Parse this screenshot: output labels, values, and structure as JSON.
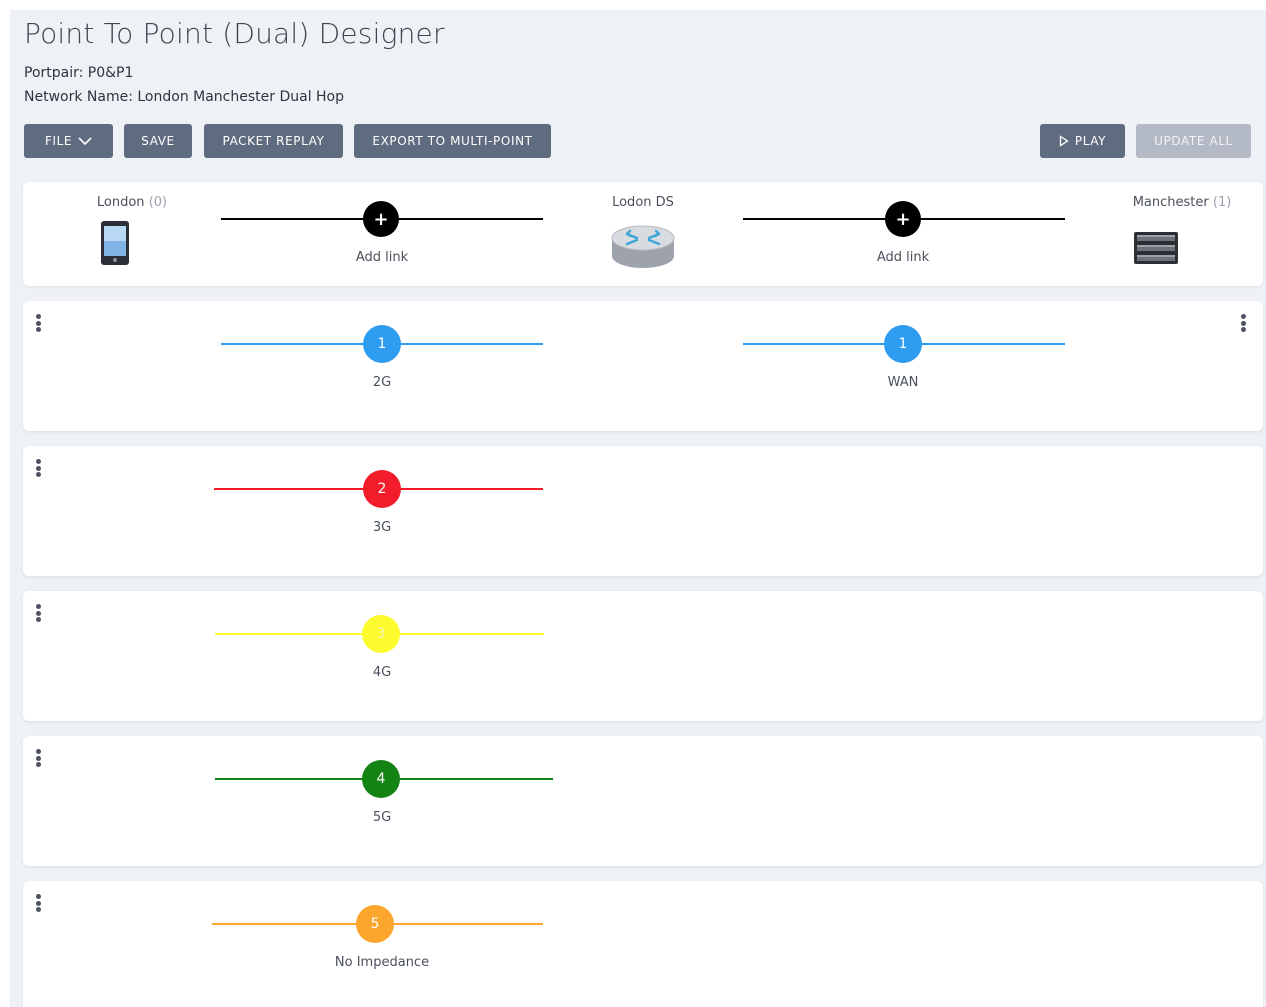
{
  "header": {
    "title": "Point To Point (Dual) Designer",
    "portpair": "Portpair: P0&P1",
    "network_name": "Network Name: London Manchester Dual Hop"
  },
  "toolbar": {
    "file": "FILE",
    "save": "SAVE",
    "packet_replay": "PACKET REPLAY",
    "export": "EXPORT TO MULTI-POINT",
    "play": "PLAY",
    "update_all": "UPDATE ALL"
  },
  "topology": {
    "left": {
      "name": "London",
      "count": "(0)",
      "icon": "mobile-phone-icon"
    },
    "middle": {
      "name": "Lodon DS",
      "icon": "router-icon"
    },
    "right": {
      "name": "Manchester",
      "count": "(1)",
      "icon": "server-icon"
    },
    "add_link_symbol": "+",
    "add_link_label": "Add link"
  },
  "links": [
    {
      "number": "1",
      "label": "2G",
      "color": "#2e9cf0",
      "wan_number": "1",
      "wan_label": "WAN"
    },
    {
      "number": "2",
      "label": "3G",
      "color": "#f21c2a"
    },
    {
      "number": "3",
      "label": "4G",
      "color": "#fbfb2e"
    },
    {
      "number": "4",
      "label": "5G",
      "color": "#138313"
    },
    {
      "number": "5",
      "label": "No Impedance",
      "color": "#fba62c"
    }
  ]
}
